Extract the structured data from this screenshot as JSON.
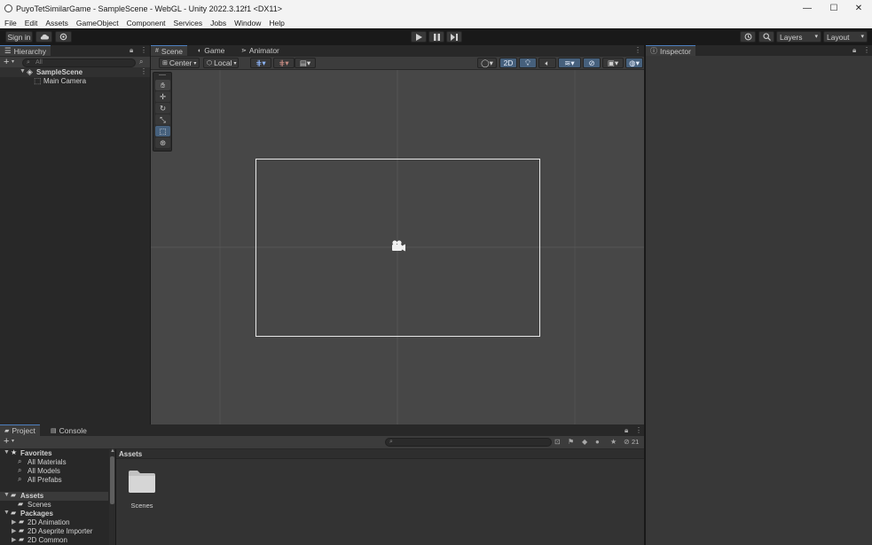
{
  "window": {
    "title": "PuyoTetSimilarGame - SampleScene - WebGL - Unity 2022.3.12f1 <DX11>",
    "controls": {
      "minimize": "—",
      "maximize": "☐",
      "close": "✕"
    }
  },
  "menu": [
    "File",
    "Edit",
    "Assets",
    "GameObject",
    "Component",
    "Services",
    "Jobs",
    "Window",
    "Help"
  ],
  "toolbar": {
    "sign_in": "Sign in",
    "cloud_icon": "cloud-icon",
    "collab_icon": "collab-icon",
    "play_icon": "play-icon",
    "pause_icon": "pause-icon",
    "step_icon": "step-icon",
    "history_icon": "history-icon",
    "search_icon": "search-icon",
    "layers": "Layers",
    "layout": "Layout"
  },
  "hierarchy": {
    "tab": "Hierarchy",
    "add": "+",
    "search_placeholder": "All",
    "scene_name": "SampleScene",
    "objects": [
      "Main Camera"
    ]
  },
  "scene_view": {
    "tabs": [
      "Scene",
      "Game",
      "Animator"
    ],
    "pivot": "Center",
    "space": "Local",
    "mode_2d": "2D",
    "tools": [
      "hand-tool-icon",
      "move-tool-icon",
      "rotate-tool-icon",
      "scale-tool-icon",
      "rect-tool-icon",
      "transform-tool-icon"
    ],
    "active_tool": "rect-tool-icon"
  },
  "inspector": {
    "tab": "Inspector"
  },
  "project": {
    "tabs": [
      "Project",
      "Console"
    ],
    "add": "+",
    "search_placeholder": "",
    "hidden_count": "21",
    "tree": {
      "favorites_label": "Favorites",
      "favorites": [
        "All Materials",
        "All Models",
        "All Prefabs"
      ],
      "assets_label": "Assets",
      "assets": [
        "Scenes"
      ],
      "packages_label": "Packages",
      "packages": [
        "2D Animation",
        "2D Aseprite Importer",
        "2D Common"
      ]
    },
    "breadcrumb": "Assets",
    "grid_items": [
      "Scenes"
    ]
  },
  "colors": {
    "accent": "#4d7fbf",
    "panel_bg": "#282828",
    "scene_bg": "#474747",
    "titlebar_bg": "#f3f3f3"
  }
}
